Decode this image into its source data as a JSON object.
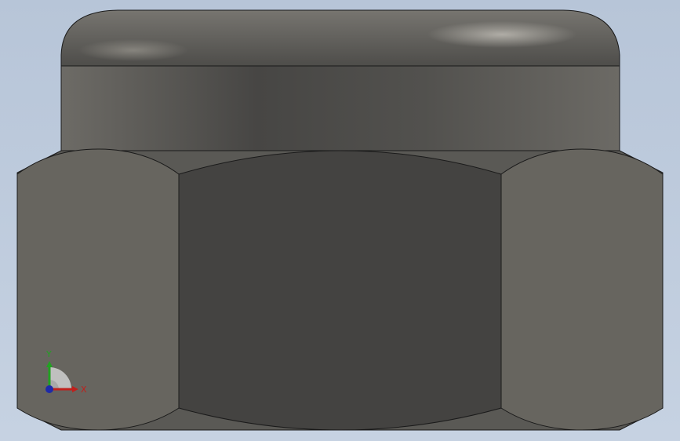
{
  "viewport": {
    "background_top": "#b7c5d8",
    "background_bottom": "#c6d2e2"
  },
  "model": {
    "part": "nylon-insert-lock-nut",
    "view": "front",
    "cap_color": "#6d6b66",
    "hex_flat_center_color": "#444341",
    "hex_flat_side_color": "#67655f",
    "edge_color": "#1a1a1a"
  },
  "triad": {
    "x_label": "X",
    "y_label": "Y",
    "x_color": "#c0201c",
    "y_color": "#22a222",
    "z_color": "#1e2aa8"
  }
}
